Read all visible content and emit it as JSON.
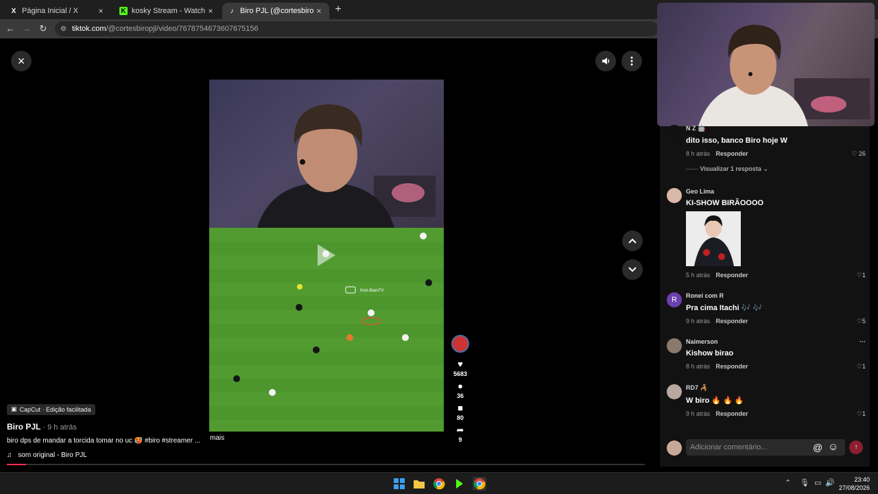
{
  "browser": {
    "tabs": [
      {
        "icon": "x-logo-icon",
        "title": "Página Inicial / X",
        "close": "×"
      },
      {
        "icon": "kick-logo-icon",
        "title": "kosky Stream - Watch Live on K",
        "close": "×"
      },
      {
        "icon": "tiktok-logo-icon",
        "title": "Biro PJL (@cortesbiropjl) | TikTo",
        "close": "×"
      }
    ],
    "new_tab": "+",
    "address": {
      "host": "tiktok.com",
      "path": "/@cortesbiropjl/video/7678754673607675156"
    }
  },
  "player": {
    "close_label": "×",
    "volume_icon": "speaker-icon",
    "more_icon": "more-vertical-icon",
    "nav_up": "⌃",
    "nav_down": "⌄"
  },
  "video": {
    "watermark": "Kick-BiamTV"
  },
  "actions": {
    "likes": "5683",
    "comments": "36",
    "saves": "80",
    "shares": "9"
  },
  "meta": {
    "capcut": "CapCut · Edição facilitada",
    "author": "Biro PJL",
    "age": " · 9 h atrás",
    "description": "biro dps de mandar a torcida tomar no uc 🥵 #biro #streamer ...",
    "more": "mais",
    "sound": "som original - Biro PJL",
    "progress_fraction": 0.03
  },
  "comments": [
    {
      "name": "N Z 🤖",
      "text": "dito isso, banco Biro hoje W",
      "time": "8 h atrás",
      "reply": "Responder",
      "likes": "26",
      "view_replies": "Visualizar 1 resposta"
    },
    {
      "name": "Geo Lima",
      "text": "KI-SHOW BIRÃOOOO",
      "time": "5 h atrás",
      "reply": "Responder",
      "likes": "1"
    },
    {
      "name": "Ronei com R",
      "avatar_letter": "R",
      "text": "Pra cima Itachi 🎶 🎶",
      "time": "9 h atrás",
      "reply": "Responder",
      "likes": "5"
    },
    {
      "name": "Naimerson",
      "text": "Kishow birao",
      "time": "8 h atrás",
      "reply": "Responder",
      "likes": "1",
      "menu": "···"
    },
    {
      "name": "RD7 🦂",
      "text": "W biro 🔥 🔥 🔥",
      "time": "9 h atrás",
      "reply": "Responder",
      "likes": "1"
    }
  ],
  "comment_input": {
    "placeholder": "Adicionar comentário...",
    "mention": "@",
    "emoji": "☺",
    "send": "↑"
  },
  "taskbar": {
    "time": "23:40",
    "date": "27/08/2026"
  }
}
